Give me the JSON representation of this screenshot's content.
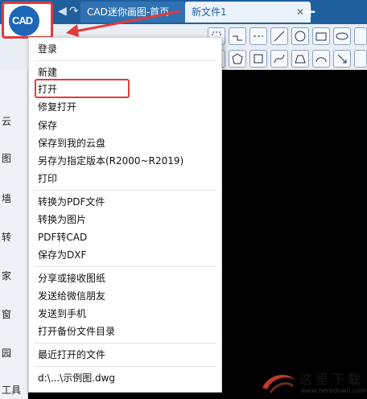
{
  "app": {
    "logo_text": "CAD",
    "tabs": [
      {
        "label": "CAD迷你画图-首页"
      },
      {
        "label": "新文件1"
      }
    ],
    "tab_close_glyph": "✕",
    "tab_add_glyph": "+"
  },
  "left_panel": {
    "glyphs": [
      "云",
      "图",
      "墙",
      "转",
      "家",
      "窗",
      "园"
    ],
    "bottom_label": "工具"
  },
  "file_menu": {
    "items": [
      {
        "label": "登录"
      },
      {
        "label": "新建"
      },
      {
        "label": "打开"
      },
      {
        "label": "修复打开"
      },
      {
        "label": "保存"
      },
      {
        "label": "保存到我的云盘"
      },
      {
        "label": "另存为指定版本(R2000~R2019)"
      },
      {
        "label": "打印"
      },
      {
        "label": "转换为PDF文件"
      },
      {
        "label": "转换为图片"
      },
      {
        "label": "PDF转CAD"
      },
      {
        "label": "保存为DXF"
      },
      {
        "label": "分享或接收图纸"
      },
      {
        "label": "发送给微信朋友"
      },
      {
        "label": "发送到手机"
      },
      {
        "label": "打开备份文件目录"
      },
      {
        "label": "最近打开的文件"
      },
      {
        "label": "d:\\...\\示例图.dwg"
      }
    ]
  },
  "watermark": {
    "text": "这里下载",
    "url": "www.heredown.com"
  },
  "colors": {
    "title_bar": "#1f5f9e",
    "highlight": "#e03c3c",
    "logo": "#1c66b8"
  }
}
